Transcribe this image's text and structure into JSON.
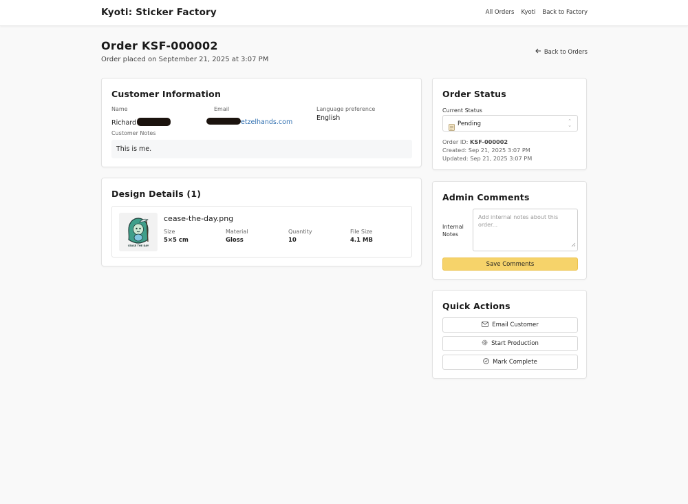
{
  "app": {
    "title": "Kyoti: Sticker Factory"
  },
  "nav": {
    "all_orders": "All Orders",
    "kyoti": "Kyoti",
    "back_factory": "Back to Factory"
  },
  "order": {
    "title": "Order KSF-000002",
    "placed": "Order placed on September 21, 2025 at 3:07 PM",
    "back_link": "Back to Orders"
  },
  "customer": {
    "section_title": "Customer Information",
    "name_label": "Name",
    "name_value": "Richard",
    "email_label": "Email",
    "email_value": "etzelhands.com",
    "lang_label": "Language preference",
    "lang_value": "English",
    "notes_label": "Customer Notes",
    "notes_value": "This is me."
  },
  "design": {
    "section_title": "Design Details (1)",
    "filename": "cease-the-day.png",
    "size_label": "Size",
    "size_value": "5×5 cm",
    "material_label": "Material",
    "material_value": "Gloss",
    "qty_label": "Quantity",
    "qty_value": "10",
    "filesize_label": "File Size",
    "filesize_value": "4.1 MB",
    "thumb_caption": "CEASE THE DAY"
  },
  "status": {
    "section_title": "Order Status",
    "current_label": "Current Status",
    "current_value": "Pending",
    "order_id_label": "Order ID:",
    "order_id_value": "KSF-000002",
    "created": "Created: Sep 21, 2025 3:07 PM",
    "updated": "Updated: Sep 21, 2025 3:07 PM"
  },
  "admin": {
    "section_title": "Admin Comments",
    "internal_label_1": "Internal",
    "internal_label_2": "Notes",
    "placeholder": "Add internal notes about this order...",
    "save_label": "Save Comments"
  },
  "quick": {
    "section_title": "Quick Actions",
    "email_label": "Email Customer",
    "production_label": "Start Production",
    "complete_label": "Mark Complete"
  },
  "colors": {
    "accent_yellow": "#f6d36a",
    "link_blue": "#2f6fb0"
  }
}
